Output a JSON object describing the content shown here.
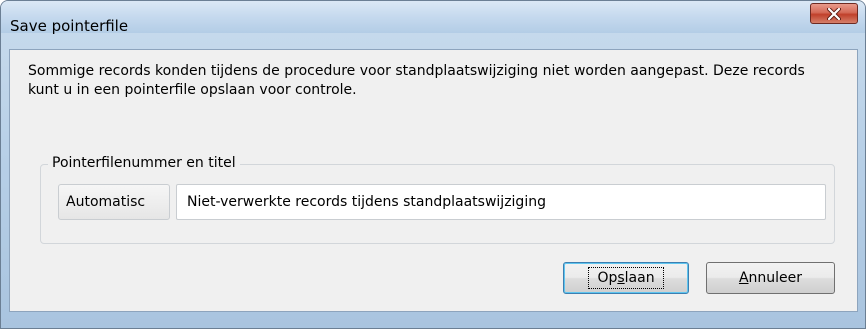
{
  "window": {
    "title": "Save pointerfile"
  },
  "message": "Sommige records konden tijdens de procedure voor standplaatswijziging niet worden aangepast. Deze records kunt u in een pointerfile opslaan voor controle.",
  "group": {
    "legend": "Pointerfilenummer en titel",
    "auto_button_label": "Automatisc",
    "title_value": "Niet-verwerkte records tijdens standplaatswijziging"
  },
  "buttons": {
    "save": {
      "before": "Op",
      "mnemonic": "s",
      "after": "laan"
    },
    "cancel": {
      "before": "",
      "mnemonic": "A",
      "after": "nnuleer"
    }
  },
  "colors": {
    "close_button": "#c0402b",
    "focus_border": "#3c7fb1"
  },
  "icons": {
    "close": "close-icon"
  }
}
